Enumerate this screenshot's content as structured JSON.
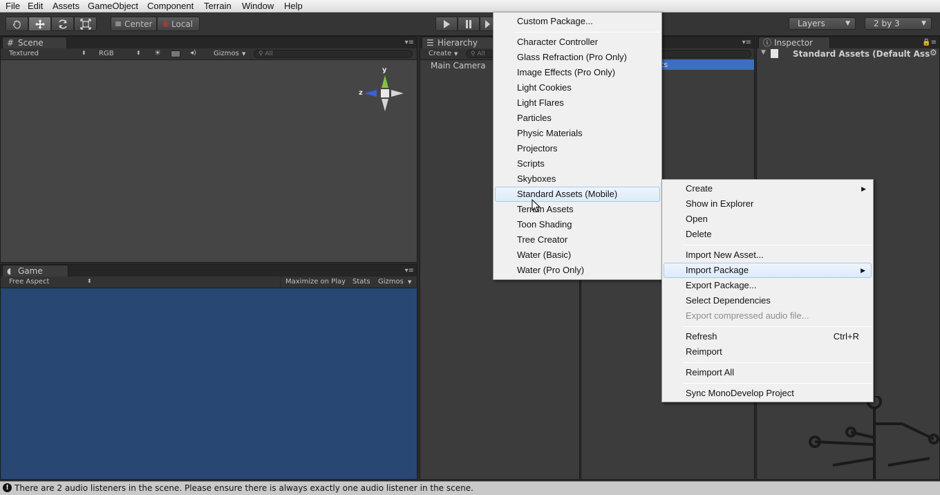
{
  "menubar": {
    "items": [
      "File",
      "Edit",
      "Assets",
      "GameObject",
      "Component",
      "Terrain",
      "Window",
      "Help"
    ]
  },
  "toolbar": {
    "pivot_label": "Center",
    "space_label": "Local",
    "layers_label": "Layers",
    "layout_label": "2 by 3"
  },
  "scene": {
    "tab": "Scene",
    "render_mode": "Textured",
    "color_mode": "RGB",
    "gizmos_label": "Gizmos",
    "search_placeholder": "All",
    "axis_y": "y",
    "axis_z": "z"
  },
  "game": {
    "tab": "Game",
    "aspect": "Free Aspect",
    "maximize_label": "Maximize on Play",
    "stats_label": "Stats",
    "gizmos_label": "Gizmos"
  },
  "hierarchy": {
    "tab": "Hierarchy",
    "create_label": "Create",
    "search_placeholder": "All",
    "items": [
      "Main Camera"
    ]
  },
  "project": {
    "selected_fragment": "ts"
  },
  "inspector": {
    "tab": "Inspector",
    "asset_title": "Standard Assets (Default Ass"
  },
  "import_package_menu": {
    "top_item": "Custom Package...",
    "items": [
      "Character Controller",
      "Glass Refraction (Pro Only)",
      "Image Effects (Pro Only)",
      "Light Cookies",
      "Light Flares",
      "Particles",
      "Physic Materials",
      "Projectors",
      "Scripts",
      "Skyboxes",
      "Standard Assets (Mobile)",
      "Terrain Assets",
      "Toon Shading",
      "Tree Creator",
      "Water (Basic)",
      "Water (Pro Only)"
    ],
    "highlighted": "Standard Assets (Mobile)"
  },
  "assets_context_menu": {
    "create": "Create",
    "show_in_explorer": "Show in Explorer",
    "open": "Open",
    "delete": "Delete",
    "import_new_asset": "Import New Asset...",
    "import_package": "Import Package",
    "export_package": "Export Package...",
    "select_dependencies": "Select Dependencies",
    "export_compressed_audio": "Export compressed audio file...",
    "refresh": "Refresh",
    "refresh_shortcut": "Ctrl+R",
    "reimport": "Reimport",
    "reimport_all": "Reimport All",
    "sync_monodevelop": "Sync MonoDevelop Project"
  },
  "status": {
    "message": "There are 2 audio listeners in the scene. Please ensure there is always exactly one audio listener in the scene."
  },
  "colors": {
    "game_background": "#284772",
    "menu_highlight": "#dcebfc",
    "project_selection": "#3d6ec1"
  }
}
